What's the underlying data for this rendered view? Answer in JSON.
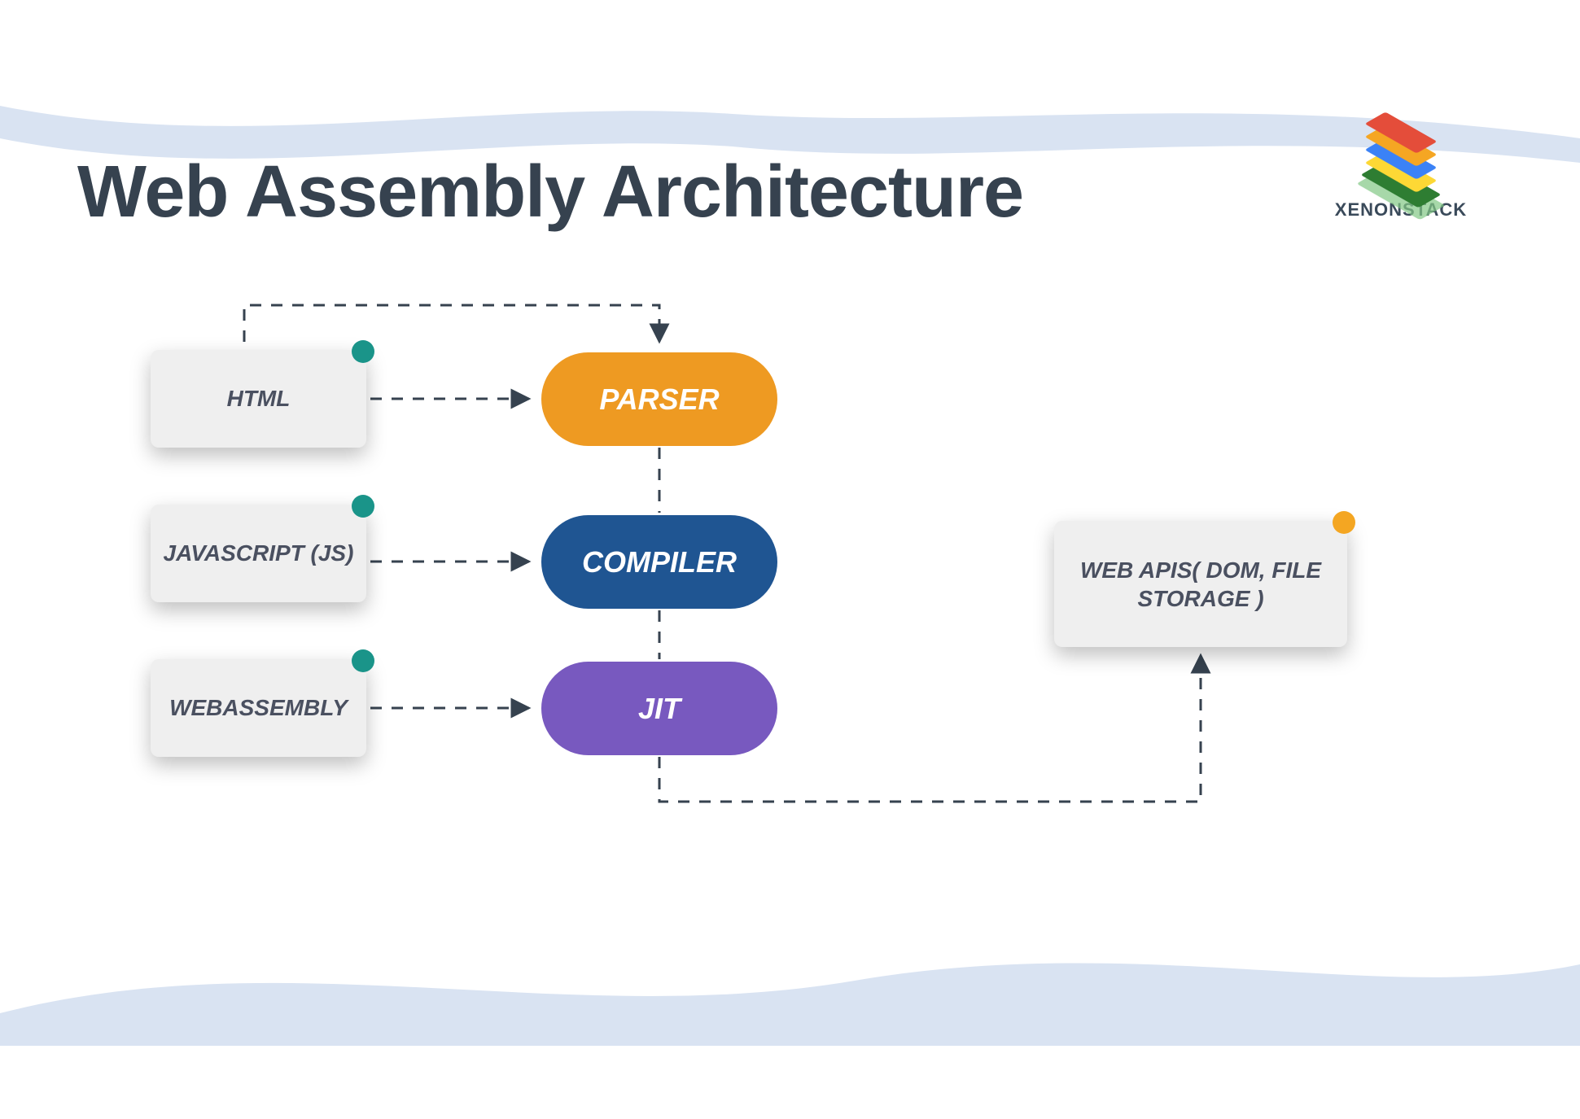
{
  "title": "Web Assembly Architecture",
  "brand": "XENONSTACK",
  "nodes": {
    "html": "HTML",
    "js": "JAVASCRIPT (JS)",
    "wasm": "WEBASSEMBLY",
    "parser": "PARSER",
    "compiler": "COMPILER",
    "jit": "JIT",
    "apis": "WEB APIS( DOM, FILE STORAGE )"
  },
  "colors": {
    "wave": "#d9e3f2",
    "title": "#36424f",
    "box_bg": "#efefef",
    "box_text": "#4a5060",
    "pill_orange": "#ee9a22",
    "pill_blue": "#1f5592",
    "pill_purple": "#7859bf",
    "dot_teal": "#1a9489",
    "dot_orange": "#f4a622",
    "connector": "#36424f"
  }
}
